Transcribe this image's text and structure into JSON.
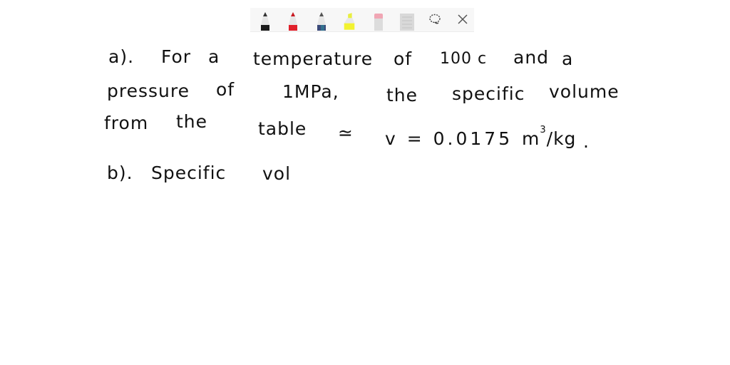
{
  "toolbar": {
    "tools": [
      {
        "name": "pen-black",
        "color": "#1a1a1a"
      },
      {
        "name": "pen-red",
        "color": "#e0202a"
      },
      {
        "name": "pen-blue",
        "color": "#3b4a7a"
      },
      {
        "name": "highlighter-yellow",
        "color": "#f2f230"
      },
      {
        "name": "eraser",
        "color": "#f0a6b4"
      },
      {
        "name": "ruler",
        "color": "#cfcfcf"
      }
    ],
    "lasso_icon": "lasso-icon",
    "close_icon": "close-icon"
  },
  "notes": {
    "line1": {
      "label": "a).",
      "w1": "For",
      "w2": "a",
      "w3": "temperature",
      "w4": "of",
      "w5": "100 c",
      "w6": "and",
      "w7": "a"
    },
    "line2": {
      "w1": "pressure",
      "w2": "of",
      "w3": "1MPa,",
      "w4": "the",
      "w5": "specific",
      "w6": "volume"
    },
    "line3": {
      "w1": "from",
      "w2": "the",
      "w3": "table",
      "w4": "≃",
      "w5": "v = 0.0175",
      "unit_m": "m",
      "unit_exp": "3",
      "unit_rest": "/kg",
      "period": "."
    },
    "line4": {
      "label": "b).",
      "w1": "Specific",
      "w2": "vol"
    }
  }
}
